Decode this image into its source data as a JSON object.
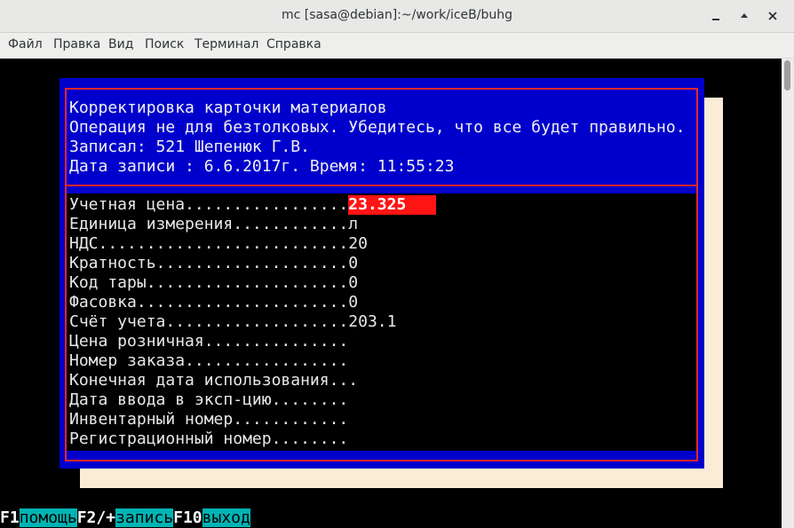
{
  "window": {
    "title": "mc [sasa@debian]:~/work/iceB/buhg",
    "controls": [
      "minimize",
      "maximize",
      "close"
    ]
  },
  "menu": {
    "items": [
      "Файл",
      "Правка",
      "Вид",
      "Поиск",
      "Терминал",
      "Справка"
    ]
  },
  "dialog": {
    "header": [
      "Корректировка карточки материалов",
      "Операция не для безтолковых. Убедитесь, что все будет правильно.",
      "Записал: 521 Шепенюк Г.В.",
      "Дата записи : 6.6.2017г. Время: 11:55:23"
    ],
    "fields": [
      {
        "label": "Учетная цена.................",
        "value": "23.325",
        "active": true
      },
      {
        "label": "Единица измерения............",
        "value": "л"
      },
      {
        "label": "НДС..........................",
        "value": "20"
      },
      {
        "label": "Кратность....................",
        "value": "0"
      },
      {
        "label": "Код тары.....................",
        "value": "0"
      },
      {
        "label": "Фасовка......................",
        "value": "0"
      },
      {
        "label": "Счёт учета...................",
        "value": "203.1"
      },
      {
        "label": "Цена розничная...............",
        "value": ""
      },
      {
        "label": "Номер заказа.................",
        "value": ""
      },
      {
        "label": "Конечная дата использования...",
        "value": ""
      },
      {
        "label": "Дата ввода в эксп-цию........",
        "value": ""
      },
      {
        "label": "Инвентарный номер............",
        "value": ""
      },
      {
        "label": "Регистрационный номер........",
        "value": ""
      }
    ]
  },
  "fkeys": [
    {
      "key": "F1",
      "label": "помощь"
    },
    {
      "key": "F2/+",
      "label": "запись"
    },
    {
      "key": "F10",
      "label": "выход"
    }
  ],
  "colors": {
    "dialog_bg": "#0000cc",
    "border": "#e6262a",
    "active_field": "#ff1414",
    "shadow": "#fbecd6",
    "fkey_label": "#00b4b4"
  }
}
